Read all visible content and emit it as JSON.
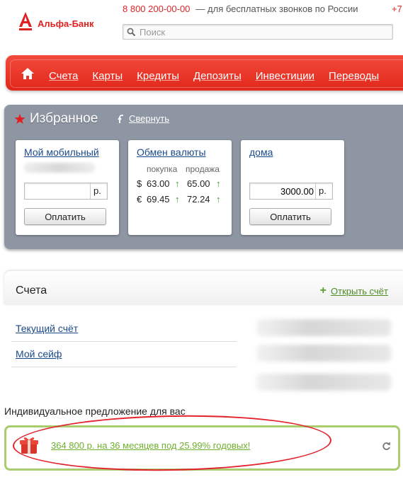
{
  "header": {
    "logo_text": "Альфа-Банк",
    "phone_number": "8 800 200-00-00",
    "phone_note": "— для бесплатных звонков по России",
    "phone_extra": "+7",
    "search_placeholder": "Поиск"
  },
  "nav": {
    "items": [
      "Счета",
      "Карты",
      "Кредиты",
      "Депозиты",
      "Инвестиции",
      "Переводы"
    ]
  },
  "favorites": {
    "title": "Избранное",
    "collapse_label": "Свернуть",
    "cards": [
      {
        "title": "Мой мобильный",
        "amount": "",
        "currency": "р.",
        "pay_label": "Оплатить"
      },
      {
        "title": "Обмен валюты",
        "buy_label": "покупка",
        "sell_label": "продажа",
        "rates": [
          {
            "symbol": "$",
            "buy": "63.00",
            "sell": "65.00",
            "arrow": "↑"
          },
          {
            "symbol": "€",
            "buy": "69.45",
            "sell": "72.24",
            "arrow": "↑"
          }
        ]
      },
      {
        "title": "дома",
        "amount": "3000.00",
        "currency": "р.",
        "pay_label": "Оплатить"
      }
    ]
  },
  "accounts": {
    "title": "Счета",
    "open_label": "Открыть счёт",
    "items": [
      "Текущий счёт",
      "Мой сейф"
    ]
  },
  "offer": {
    "label": "Индивидуальное предложение для вас",
    "link_text": "364 800 р. на 36 месяцев под 25.99% годовых!"
  },
  "colors": {
    "brand_red": "#e02020",
    "offer_green": "#6fb02c",
    "nav_red": "#f34a3c"
  }
}
